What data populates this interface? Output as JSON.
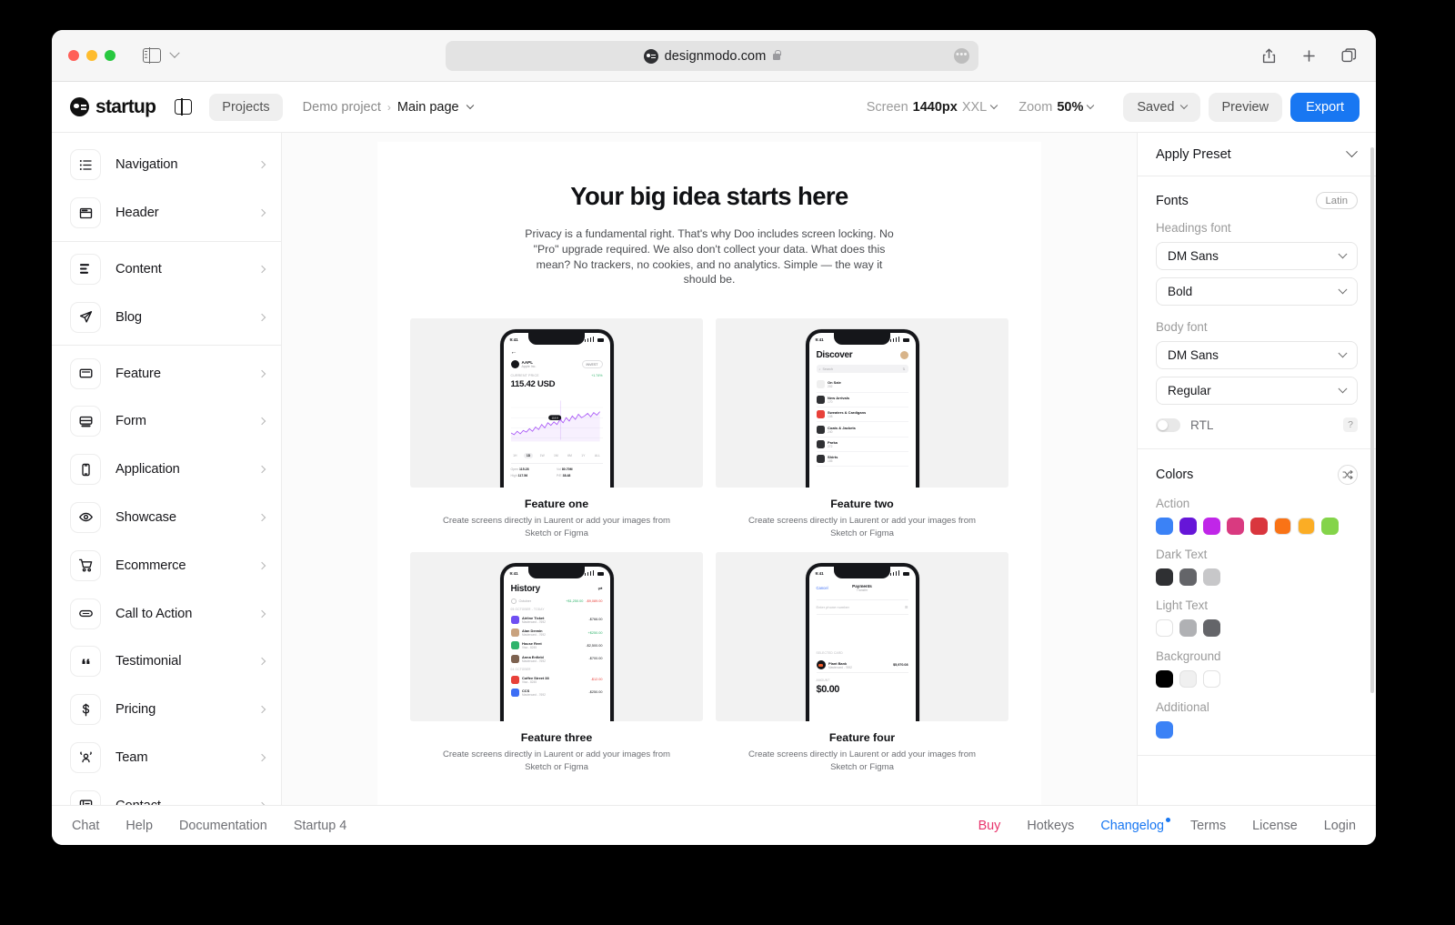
{
  "browser": {
    "url": "designmodo.com",
    "traffic_lights": [
      "close",
      "minimize",
      "maximize"
    ],
    "icons": [
      "sidebar-icon",
      "chevron-down-icon",
      "share-icon",
      "new-tab-icon",
      "tab-overview-icon",
      "lock-icon",
      "more-icon"
    ],
    "more_label": "•••"
  },
  "appbar": {
    "logo_text": "startup",
    "projects_label": "Projects",
    "breadcrumb": {
      "project": "Demo project",
      "separator": "›",
      "page": "Main page"
    },
    "screen": {
      "label": "Screen",
      "value": "1440px",
      "suffix": "XXL"
    },
    "zoom": {
      "label": "Zoom",
      "value": "50%"
    },
    "saved_label": "Saved",
    "preview_label": "Preview",
    "export_label": "Export",
    "export_color": "#1877f2"
  },
  "sidebar": {
    "items": [
      {
        "label": "Navigation",
        "icon": "list-icon"
      },
      {
        "label": "Header",
        "icon": "header-layout-icon"
      },
      {
        "label": "Content",
        "icon": "content-align-icon"
      },
      {
        "label": "Blog",
        "icon": "paper-plane-icon"
      },
      {
        "label": "Feature",
        "icon": "window-icon"
      },
      {
        "label": "Form",
        "icon": "form-icon"
      },
      {
        "label": "Application",
        "icon": "mobile-icon"
      },
      {
        "label": "Showcase",
        "icon": "eye-icon"
      },
      {
        "label": "Ecommerce",
        "icon": "cart-icon"
      },
      {
        "label": "Call to Action",
        "icon": "button-pill-icon"
      },
      {
        "label": "Testimonial",
        "icon": "quote-icon"
      },
      {
        "label": "Pricing",
        "icon": "dollar-icon"
      },
      {
        "label": "Team",
        "icon": "people-icon"
      },
      {
        "label": "Contact",
        "icon": "contact-card-icon"
      }
    ],
    "dividers_after": [
      1,
      3
    ]
  },
  "canvas": {
    "hero_title": "Your big idea starts here",
    "hero_paragraph": "Privacy is a fundamental right. That's why Doo includes screen locking. No \"Pro\" upgrade required. We also don't collect your data. What does this mean? No trackers, no cookies, and no analytics. Simple — the way it should be.",
    "features": [
      {
        "title": "Feature one",
        "subtitle": "Create screens directly in Laurent or add your images from Sketch or Figma",
        "screen": {
          "kind": "stock",
          "time": "9:41",
          "ticker": "AAPL",
          "company": "Apple Inc.",
          "action": "INVEST",
          "price_label": "CURRENT PRICE",
          "price": "115.42 USD",
          "change": "+1.74%",
          "chart_color": "#a855f7",
          "tooltip": "118.8",
          "range_tabs": [
            "1H",
            "1D",
            "1W",
            "1M",
            "6M",
            "1Y",
            "ALL"
          ],
          "selected_range": "1D",
          "stats": [
            {
              "label": "Open",
              "value": "115.28"
            },
            {
              "label": "Vol",
              "value": "80.70M"
            },
            {
              "label": "High",
              "value": "117.56"
            },
            {
              "label": "P/E",
              "value": "38.48"
            }
          ]
        }
      },
      {
        "title": "Feature two",
        "subtitle": "Create screens directly in Laurent or add your images from Sketch or Figma",
        "screen": {
          "kind": "shop",
          "time": "9:41",
          "heading": "Discover",
          "search_placeholder": "Search",
          "categories": [
            {
              "name": "On Sale",
              "count": "202",
              "color": "#efefef"
            },
            {
              "name": "New Arrivals",
              "count": "170",
              "color": "#2f3033"
            },
            {
              "name": "Sweaters & Cardigans",
              "count": "108",
              "color": "#e8413a"
            },
            {
              "name": "Coats & Jackets",
              "count": "240",
              "color": "#2f3033"
            },
            {
              "name": "Parka",
              "count": "272",
              "color": "#2f3033"
            },
            {
              "name": "Shirts",
              "count": "155",
              "color": "#2f3033"
            }
          ]
        }
      },
      {
        "title": "Feature three",
        "subtitle": "Create screens directly in Laurent or add your images from Sketch or Figma",
        "screen": {
          "kind": "history",
          "time": "9:41",
          "heading": "History",
          "month": "October",
          "income": "+$1,250.00",
          "expense": "-$9,089.00",
          "group_label": "05 OCTOBER - TODAY",
          "group_label_2": "04 OCTOBER",
          "rows": [
            {
              "name": "Airline Ticket",
              "meta": "Mastercard - 7692",
              "amount": "-$766.00",
              "positive": false,
              "color": "#6f4ff2"
            },
            {
              "name": "Alan Derwin",
              "meta": "Mastercard - 7692",
              "amount": "+$250.00",
              "positive": true,
              "color": "#c9a27e"
            },
            {
              "name": "House Rent",
              "meta": "Visa - 8245",
              "amount": "-$2,500.00",
              "positive": false,
              "color": "#2fb36b"
            },
            {
              "name": "Anna Enfield",
              "meta": "Mastercard - 7692",
              "amount": "-$700.00",
              "positive": false,
              "color": "#7d6250"
            },
            {
              "name": "Coffee Street 38",
              "meta": "Visa - 8245",
              "amount": "-$12.00",
              "positive": false,
              "color": "#e8413a"
            },
            {
              "name": "CCS",
              "meta": "Mastercard - 7692",
              "amount": "-$250.00",
              "positive": false,
              "color": "#3d6ef5"
            }
          ]
        }
      },
      {
        "title": "Feature four",
        "subtitle": "Create screens directly in Laurent or add your images from Sketch or Figma",
        "screen": {
          "kind": "payment",
          "time": "9:41",
          "cancel_label": "Cancel",
          "heading": "Payments",
          "subheading": "Transfer",
          "phone_placeholder": "Enter phone number",
          "card_section_label": "SELECTED CARD",
          "card_name": "Plant Bank",
          "card_meta": "Mastercard - 7692",
          "card_balance": "$5,970.08",
          "amount_label": "AMOUNT",
          "amount": "$0.00"
        }
      }
    ]
  },
  "right_panel": {
    "preset_label": "Apply Preset",
    "fonts": {
      "title": "Fonts",
      "badge": "Latin",
      "headings_label": "Headings font",
      "headings_family": "DM Sans",
      "headings_weight": "Bold",
      "body_label": "Body font",
      "body_family": "DM Sans",
      "body_weight": "Regular",
      "rtl_label": "RTL",
      "help_label": "?"
    },
    "colors": {
      "title": "Colors",
      "shuffle_icon": "shuffle-icon",
      "groups": [
        {
          "label": "Action",
          "swatches": [
            "#3b82f6",
            "#6616d8",
            "#c026e8",
            "#d93a80",
            "#d9363e",
            "#f97316",
            "#fbad25",
            "#84d44a"
          ]
        },
        {
          "label": "Dark Text",
          "swatches": [
            "#2f3033",
            "#646569",
            "#c7c7c9"
          ]
        },
        {
          "label": "Light Text",
          "swatches": [
            "#ffffff",
            "#b0b1b4",
            "#646569"
          ]
        },
        {
          "label": "Background",
          "swatches": [
            "#000000",
            "#f0f0f0",
            "#ffffff"
          ]
        },
        {
          "label": "Additional",
          "swatches": [
            "#3b82f6"
          ]
        }
      ]
    }
  },
  "footer": {
    "left_links": [
      "Chat",
      "Help",
      "Documentation",
      "Startup 4"
    ],
    "right_links": [
      {
        "label": "Buy",
        "style": "buy"
      },
      {
        "label": "Hotkeys",
        "style": "normal"
      },
      {
        "label": "Changelog",
        "style": "changelog",
        "badge": true
      },
      {
        "label": "Terms",
        "style": "normal"
      },
      {
        "label": "License",
        "style": "normal"
      },
      {
        "label": "Login",
        "style": "normal"
      }
    ]
  }
}
